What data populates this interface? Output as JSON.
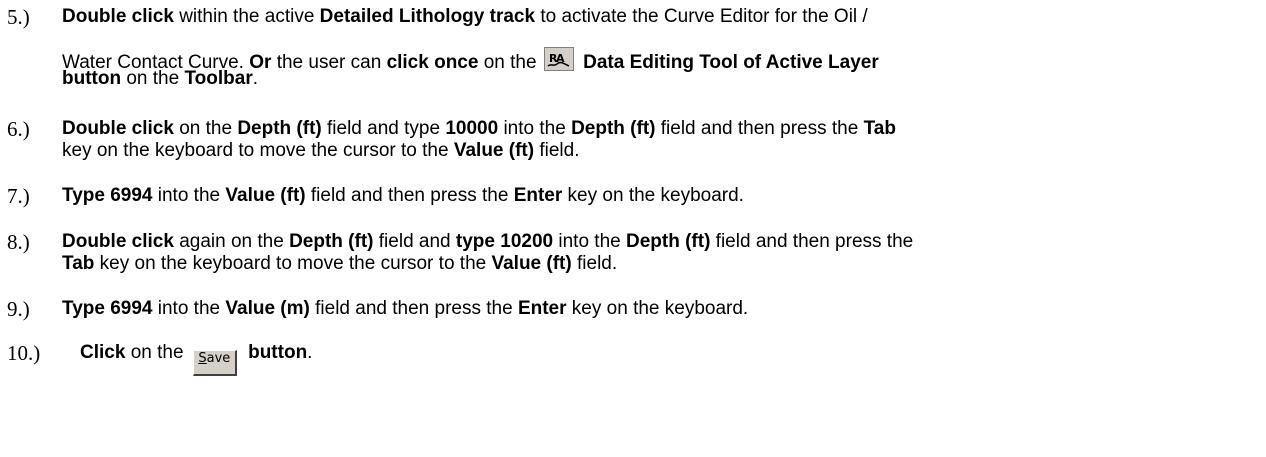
{
  "steps": [
    {
      "num": "5.)",
      "p1": "Double click",
      "p2": " within the active ",
      "p3": "Detailed Lithology track",
      "p4": " to activate the Curve Editor for the Oil /",
      "p5": "Water Contact Curve. ",
      "p6": "Or",
      "p7": " the user can ",
      "p8": "click once",
      "p9": " on the ",
      "p10": " Data Editing Tool of Active Layer",
      "p11": "button",
      "p12": " on the ",
      "p13": "Toolbar",
      "p14": ".",
      "icon": "data-editing-tool-icon"
    },
    {
      "num": "6.)",
      "p1": "Double click",
      "p2": " on the ",
      "p3": "Depth (ft)",
      "p4": " field and type ",
      "p5": "10000",
      "p6": " into the ",
      "p7": "Depth (ft)",
      "p8": " field and then press the ",
      "p9": "Tab",
      "p10": "key on the keyboard to move the cursor to the ",
      "p11": "Value (ft)",
      "p12": " field."
    },
    {
      "num": "7.)",
      "p1": "Type 6994",
      "p2": " into the ",
      "p3": "Value (ft)",
      "p4": " field and then press the ",
      "p5": "Enter",
      "p6": " key on the keyboard."
    },
    {
      "num": "8.)",
      "p1": "Double click",
      "p2": " again on the ",
      "p3": "Depth (ft)",
      "p4": " field and ",
      "p5": "type 10200",
      "p6": " into the ",
      "p7": "Depth (ft)",
      "p8": " field and then press the",
      "p9": "Tab",
      "p10": " key on the keyboard to move the cursor to the ",
      "p11": "Value (ft)",
      "p12": " field."
    },
    {
      "num": "9.)",
      "p1": "Type 6994",
      "p2": " into the ",
      "p3": "Value (m)",
      "p4": " field and then press the ",
      "p5": "Enter",
      "p6": " key on the keyboard."
    },
    {
      "num": "10.)",
      "p1": "Click",
      "p2": " on the ",
      "p3": " button",
      "p4": ".",
      "save_label_first": "S",
      "save_label_rest": "ave"
    }
  ]
}
